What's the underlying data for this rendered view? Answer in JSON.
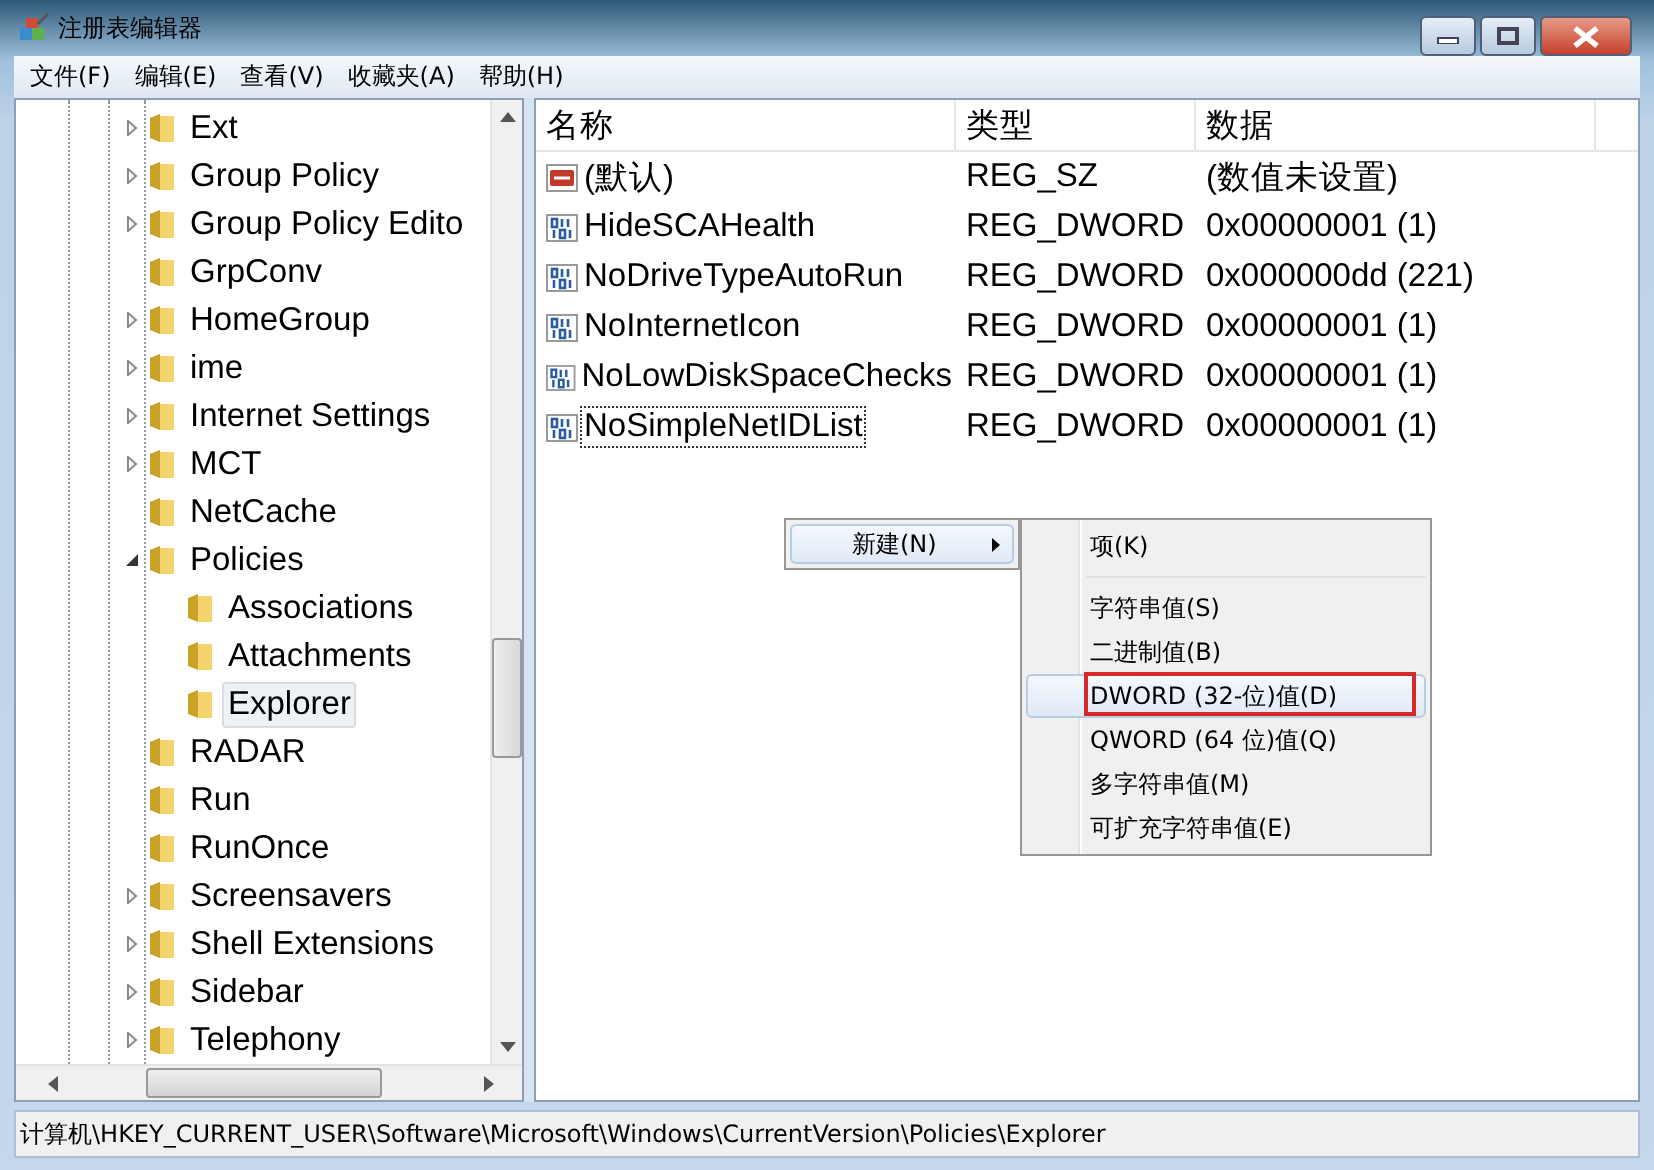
{
  "window": {
    "title": "注册表编辑器"
  },
  "menu": [
    "文件(F)",
    "编辑(E)",
    "查看(V)",
    "收藏夹(A)",
    "帮助(H)"
  ],
  "tree": [
    {
      "label": "Ext",
      "expandable": true,
      "expanded": false,
      "selected": false
    },
    {
      "label": "Group Policy",
      "expandable": true,
      "expanded": false,
      "selected": false
    },
    {
      "label": "Group Policy Edito",
      "expandable": true,
      "expanded": false,
      "selected": false
    },
    {
      "label": "GrpConv",
      "expandable": false,
      "selected": false
    },
    {
      "label": "HomeGroup",
      "expandable": true,
      "expanded": false,
      "selected": false
    },
    {
      "label": "ime",
      "expandable": true,
      "expanded": false,
      "selected": false
    },
    {
      "label": "Internet Settings",
      "expandable": true,
      "expanded": false,
      "selected": false
    },
    {
      "label": "MCT",
      "expandable": true,
      "expanded": false,
      "selected": false
    },
    {
      "label": "NetCache",
      "expandable": false,
      "selected": false
    },
    {
      "label": "Policies",
      "expandable": true,
      "expanded": true,
      "selected": false,
      "children": [
        {
          "label": "Associations",
          "expandable": false,
          "selected": false
        },
        {
          "label": "Attachments",
          "expandable": false,
          "selected": false
        },
        {
          "label": "Explorer",
          "expandable": false,
          "selected": true
        }
      ]
    },
    {
      "label": "RADAR",
      "expandable": false,
      "selected": false
    },
    {
      "label": "Run",
      "expandable": false,
      "selected": false
    },
    {
      "label": "RunOnce",
      "expandable": false,
      "selected": false
    },
    {
      "label": "Screensavers",
      "expandable": true,
      "expanded": false,
      "selected": false
    },
    {
      "label": "Shell Extensions",
      "expandable": true,
      "expanded": false,
      "selected": false
    },
    {
      "label": "Sidebar",
      "expandable": true,
      "expanded": false,
      "selected": false
    },
    {
      "label": "Telephony",
      "expandable": true,
      "expanded": false,
      "selected": false
    }
  ],
  "table": {
    "columns": [
      "名称",
      "类型",
      "数据"
    ],
    "rows": [
      {
        "kind": "string",
        "name": "(默认)",
        "type": "REG_SZ",
        "data": "(数值未设置)",
        "focused": false
      },
      {
        "kind": "dword",
        "name": "HideSCAHealth",
        "type": "REG_DWORD",
        "data": "0x00000001 (1)",
        "focused": false
      },
      {
        "kind": "dword",
        "name": "NoDriveTypeAutoRun",
        "type": "REG_DWORD",
        "data": "0x000000dd (221)",
        "focused": false
      },
      {
        "kind": "dword",
        "name": "NoInternetIcon",
        "type": "REG_DWORD",
        "data": "0x00000001 (1)",
        "focused": false
      },
      {
        "kind": "dword",
        "name": "NoLowDiskSpaceChecks",
        "type": "REG_DWORD",
        "data": "0x00000001 (1)",
        "focused": false
      },
      {
        "kind": "dword",
        "name": "NoSimpleNetIDList",
        "type": "REG_DWORD",
        "data": "0x00000001 (1)",
        "focused": true
      }
    ]
  },
  "context_menu": {
    "items": [
      {
        "label": "新建(N)",
        "selected": true,
        "has_submenu": true
      }
    ],
    "submenu": [
      {
        "label": "项(K)",
        "selected": false,
        "outlined": false,
        "separator_after": true
      },
      {
        "label": "字符串值(S)",
        "selected": false,
        "outlined": false,
        "separator_after": false
      },
      {
        "label": "二进制值(B)",
        "selected": false,
        "outlined": false,
        "separator_after": false
      },
      {
        "label": "DWORD (32-位)值(D)",
        "selected": true,
        "outlined": true,
        "separator_after": false
      },
      {
        "label": "QWORD (64 位)值(Q)",
        "selected": false,
        "outlined": false,
        "separator_after": false
      },
      {
        "label": "多字符串值(M)",
        "selected": false,
        "outlined": false,
        "separator_after": false
      },
      {
        "label": "可扩充字符串值(E)",
        "selected": false,
        "outlined": false,
        "separator_after": false
      }
    ]
  },
  "status_bar": "计算机\\HKEY_CURRENT_USER\\Software\\Microsoft\\Windows\\CurrentVersion\\Policies\\Explorer"
}
